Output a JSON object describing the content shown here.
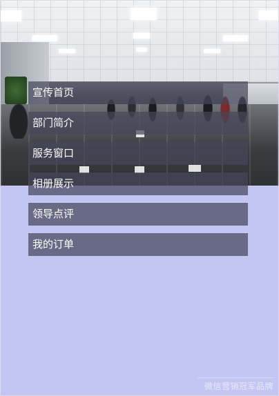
{
  "menu": {
    "items": [
      {
        "label": "宣传首页"
      },
      {
        "label": "部门简介"
      },
      {
        "label": "服务窗口"
      },
      {
        "label": "相册展示"
      },
      {
        "label": "领导点评"
      },
      {
        "label": "我的订单"
      }
    ]
  },
  "footer": {
    "brand": "微信营销冠军品牌"
  },
  "colors": {
    "background": "#c3c5f3",
    "menu_item": "#46465a"
  }
}
